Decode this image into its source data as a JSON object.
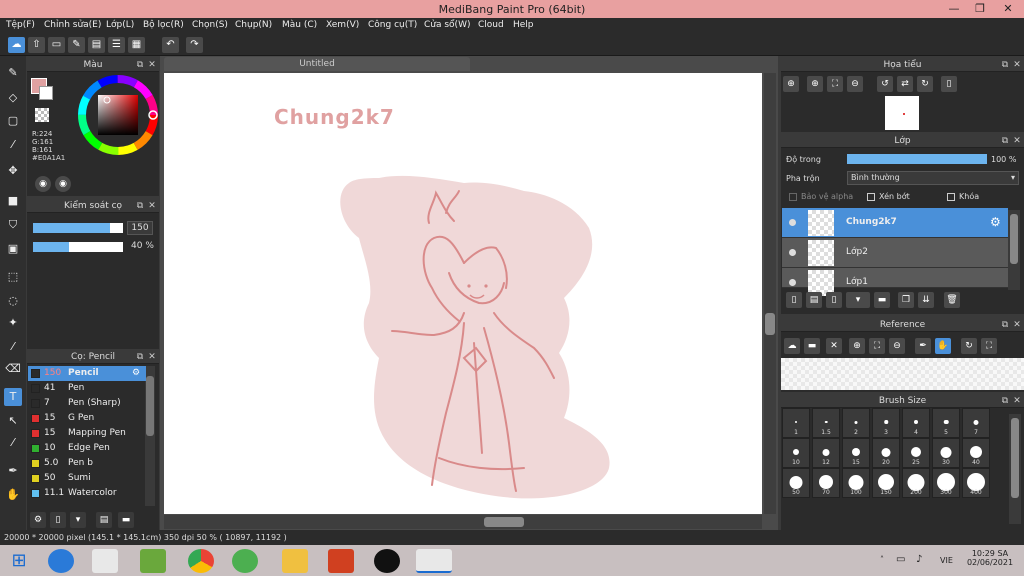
{
  "app": {
    "title": "MediBang Paint Pro (64bit)"
  },
  "menu": [
    "Tệp(F)",
    "Chỉnh sửa(E)",
    "Lớp(L)",
    "Bộ lọc(R)",
    "Chọn(S)",
    "Chụp(N)",
    "Màu (C)",
    "Xem(V)",
    "Công cụ(T)",
    "Cửa sổ(W)",
    "Cloud",
    "Help"
  ],
  "canvas_tab": "Untitled",
  "canvas_text": "Chung2k7",
  "color_panel": {
    "title": "Màu",
    "r": "R:224",
    "g": "G:161",
    "b": "B:161",
    "hex": "#E0A1A1",
    "fg_color": "#E0A1A1"
  },
  "brush_control": {
    "title": "Kiểm soát cọ",
    "size": "150",
    "opacity": "40 %",
    "size_fraction": 0.85,
    "opacity_fraction": 0.4
  },
  "brush_panel": {
    "title": "Cọ: Pencil",
    "brushes": [
      {
        "size": "150",
        "name": "Pencil",
        "color": "#2a2a2a",
        "selected": true
      },
      {
        "size": "41",
        "name": "Pen",
        "color": "#2a2a2a"
      },
      {
        "size": "7",
        "name": "Pen (Sharp)",
        "color": "#2a2a2a"
      },
      {
        "size": "15",
        "name": "G Pen",
        "color": "#e03030"
      },
      {
        "size": "15",
        "name": "Mapping Pen",
        "color": "#e03030"
      },
      {
        "size": "10",
        "name": "Edge Pen",
        "color": "#30b030"
      },
      {
        "size": "5.0",
        "name": "Pen b",
        "color": "#e0d020"
      },
      {
        "size": "50",
        "name": "Sumi",
        "color": "#e0d020"
      },
      {
        "size": "11.1",
        "name": "Watercolor",
        "color": "#60c0f0"
      }
    ]
  },
  "navigator": {
    "title": "Họa tiểu"
  },
  "layer_panel": {
    "title": "Lớp",
    "opacity_label": "Độ trong",
    "opacity_value": "100 %",
    "blend_label": "Pha trộn",
    "blend_value": "Bình thường",
    "protect_alpha": "Bảo vệ alpha",
    "clipping": "Xén bớt",
    "lock": "Khóa",
    "layers": [
      {
        "name": "Chung2k7",
        "selected": true
      },
      {
        "name": "Lớp2"
      },
      {
        "name": "Lớp1"
      }
    ]
  },
  "reference": {
    "title": "Reference"
  },
  "brush_size": {
    "title": "Brush Size",
    "sizes": [
      "1",
      "1.5",
      "2",
      "3",
      "4",
      "5",
      "7",
      "10",
      "12",
      "15",
      "20",
      "25",
      "30",
      "40",
      "50",
      "70",
      "100",
      "150",
      "200",
      "300",
      "400"
    ]
  },
  "status": {
    "text": "20000 * 20000 pixel   (145.1 * 145.1cm)   350 dpi   50 %   ( 10897, 11192 )"
  },
  "taskbar": {
    "time": "10:29 SA",
    "date": "02/06/2021",
    "lang": "VIE"
  }
}
